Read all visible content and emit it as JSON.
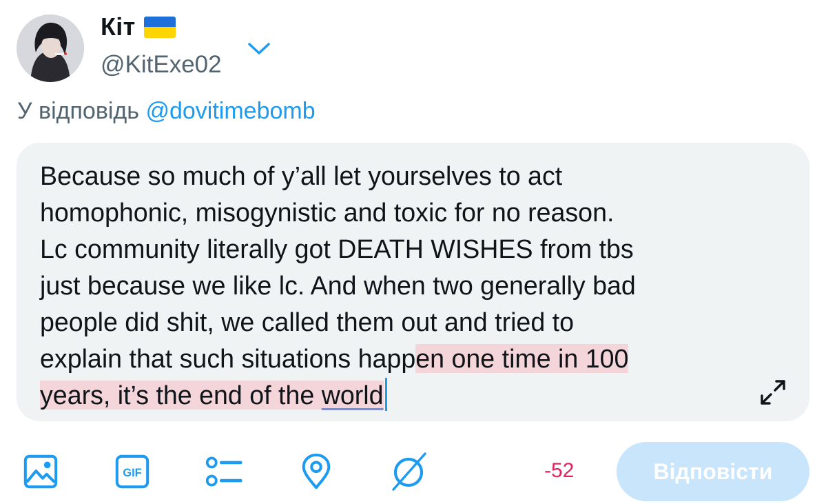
{
  "user": {
    "display_name": "Кіт",
    "handle": "@KitExe02"
  },
  "reply": {
    "prefix": "У відповідь",
    "mention": "@dovitimebomb"
  },
  "composer": {
    "text_normal": "Because so much of y’all let yourselves to act\nhomophonic, misogynistic and toxic for no reason.\nLc community literally got DEATH WISHES from tbs\njust because we like lc. And when two generally bad\npeople did shit, we called them out and tried to\nexplain that such situations happ",
    "text_overflow_a": "en one time in 100\nyears, it’s the end of the ",
    "text_overflow_b": "world"
  },
  "toolbar": {
    "icons": [
      "image-icon",
      "gif-icon",
      "poll-icon",
      "location-icon",
      "circle-icon"
    ],
    "char_count": "-52",
    "reply_label": "Відповісти"
  },
  "colors": {
    "accent": "#1d9bf0",
    "overflow_highlight": "#f4d5da",
    "counter_red": "#e0245e",
    "disabled_button": "#c8e5fb"
  }
}
